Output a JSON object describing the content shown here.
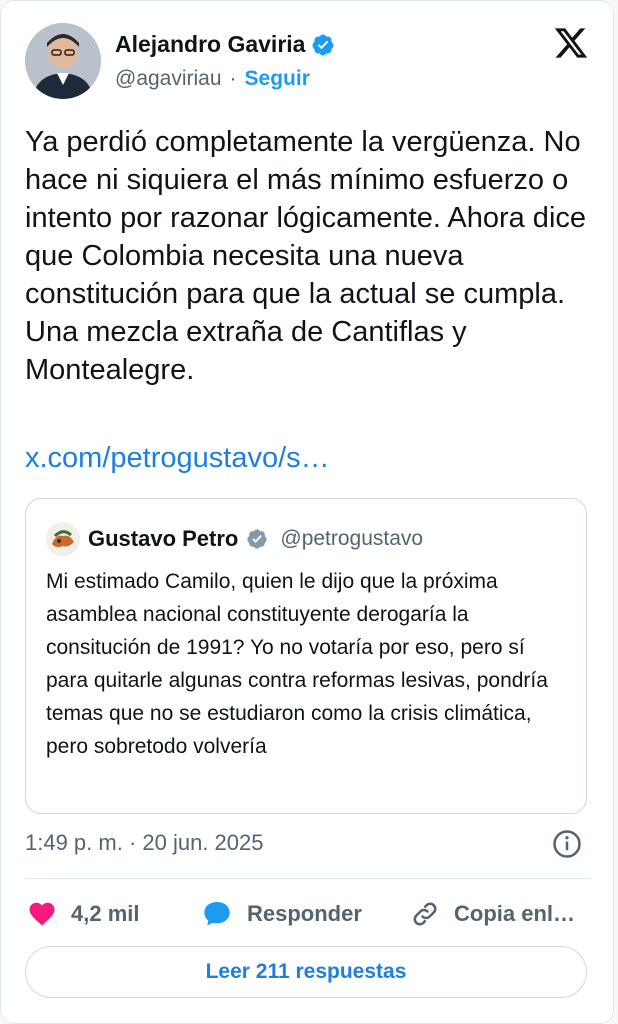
{
  "author": {
    "name": "Alejandro Gaviria",
    "handle": "@agaviriau",
    "separator": "·",
    "follow_label": "Seguir",
    "verified_icon": "verified-badge-icon"
  },
  "tweet": {
    "text": "Ya perdió completamente la vergüenza. No hace ni siquiera el más mínimo esfuerzo o intento por razonar lógicamente. Ahora dice que Colombia necesita una nueva constitución para que la actual se cumpla. Una mezcla extraña de Cantiflas y Montealegre.",
    "link": "x.com/petrogustavo/s…",
    "timestamp": "1:49 p. m. · 20 jun. 2025"
  },
  "quote": {
    "name": "Gustavo Petro",
    "handle": "@petrogustavo",
    "text": "Mi estimado Camilo, quien le dijo que la próxima asamblea nacional constituyente derogaría la consitución de 1991? Yo no votaría por eso, pero sí para quitarle algunas contra reformas lesivas, pondría temas que no se estudiaron como la crisis climática, pero sobretodo volvería"
  },
  "actions": {
    "likes": "4,2 mil",
    "reply_label": "Responder",
    "copy_label": "Copia enl…"
  },
  "read_replies": "Leer 211 respuestas",
  "colors": {
    "accent": "#1d9bf0",
    "link": "#1d7fe0",
    "heart": "#f91880",
    "secondary_text": "#536471"
  }
}
